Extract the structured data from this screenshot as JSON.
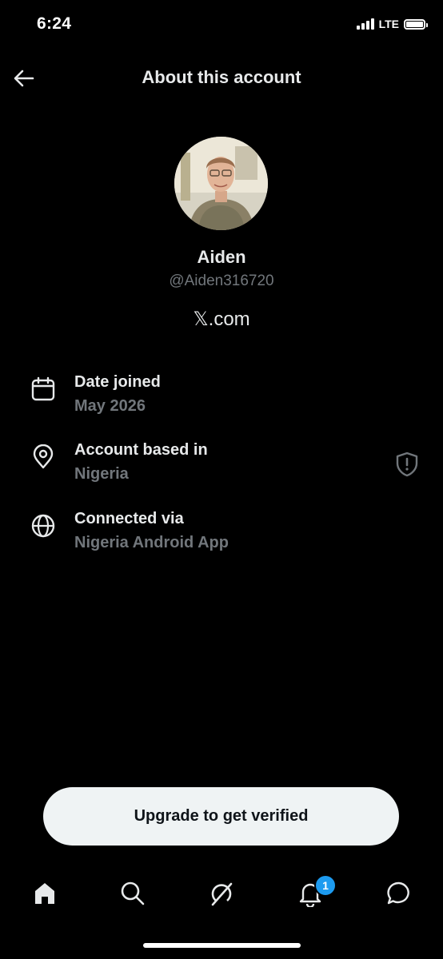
{
  "status_bar": {
    "time": "6:24",
    "network": "LTE"
  },
  "header": {
    "back_icon": "arrow-left-icon",
    "title": "About this account"
  },
  "profile": {
    "name": "Aiden",
    "handle": "@Aiden316720",
    "site": "𝕏.com"
  },
  "info": [
    {
      "icon": "calendar-icon",
      "label": "Date joined",
      "value": "May 2026"
    },
    {
      "icon": "location-pin-icon",
      "label": "Account based in",
      "value": "Nigeria",
      "extra_icon": "shield-icon"
    },
    {
      "icon": "globe-icon",
      "label": "Connected via",
      "value": "Nigeria Android App"
    }
  ],
  "upgrade_button": {
    "label": "Upgrade to get verified"
  },
  "bottom_nav": {
    "items": [
      "home-icon",
      "search-icon",
      "grok-icon",
      "notifications-icon",
      "messages-icon"
    ],
    "notifications_badge": "1"
  },
  "colors": {
    "background": "#000000",
    "primary_text": "#e7e9ea",
    "secondary_text": "#71767b",
    "accent": "#1d9bf0",
    "button_bg": "#eff3f4"
  }
}
